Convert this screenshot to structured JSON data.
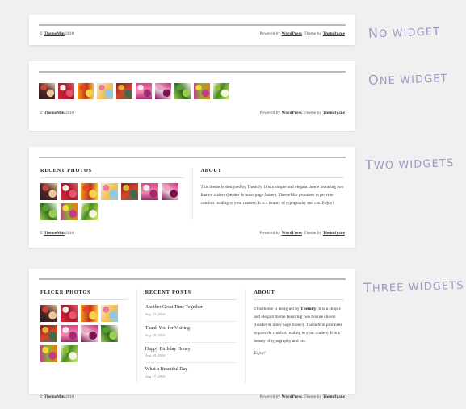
{
  "page": {
    "background": "#f0f0f0",
    "annotation_color": "#9a9ac4"
  },
  "footer": {
    "copyright_symbol": "©",
    "site_name": "ThemeMin",
    "year": "2010",
    "powered_prefix": "Powered by",
    "wordpress": "WordPress",
    "theme_prefix": ". Theme by",
    "themify": "Themify.me"
  },
  "annotations": [
    {
      "id": "no-widget",
      "first": "N",
      "rest": "o widget"
    },
    {
      "id": "one-widget",
      "first": "O",
      "rest": "ne widget"
    },
    {
      "id": "two-widgets",
      "first": "T",
      "rest": "wo widgets"
    },
    {
      "id": "three-widgets",
      "first": "T",
      "rest": "hree widgets"
    }
  ],
  "panels": {
    "no_widget": {
      "label": "No widget"
    },
    "one_widget": {
      "label": "One widget",
      "thumb_count": 10
    },
    "two_widgets": {
      "label": "Two widgets",
      "photos": {
        "heading": "Recent Photos",
        "thumb_count": 10
      },
      "about": {
        "heading": "About",
        "body": "This theme is designed by Themify. It is a simple and elegant theme featuring two feature sliders (header & inner page footer). ThemeMin promises to provide comfort reading to your readers. It is a beauty of typography and css. Enjoy!"
      }
    },
    "three_widgets": {
      "label": "Three widgets",
      "flickr": {
        "heading": "Flickr Photos",
        "thumb_count": 10
      },
      "posts": {
        "heading": "Recent Posts",
        "items": [
          {
            "title": "Another Great Time Together",
            "date": "Aug 22, 2010"
          },
          {
            "title": "Thank You for Visiting",
            "date": "Aug 19, 2010"
          },
          {
            "title": "Happy Birthday Honey",
            "date": "Aug 18, 2010"
          },
          {
            "title": "What a Beautiful Day",
            "date": "Aug 17, 2010"
          }
        ]
      },
      "about": {
        "heading": "About",
        "body_before_link": "This theme is designed by ",
        "link_text": "Themify",
        "body_after_link": ". It is a simple and elegant theme featuring two feature sliders (header & inner page footer). ThemeMin promises to provide comfort reading to your readers. It is a beauty of typography and css.",
        "closing": "Enjoy!"
      }
    }
  },
  "thumbnails": [
    {
      "name": "photo-dark-figure",
      "colors": [
        "#2b1b1d",
        "#c8463a",
        "#e8c79a",
        "#5a2a2c"
      ]
    },
    {
      "name": "photo-white-figure",
      "colors": [
        "#d6263c",
        "#f4f0ea",
        "#e2556a",
        "#a8172c"
      ]
    },
    {
      "name": "photo-orange-swirl",
      "colors": [
        "#f0a020",
        "#e8432a",
        "#f7d24a",
        "#c23018"
      ]
    },
    {
      "name": "photo-pastel-dancer",
      "colors": [
        "#f2e6dc",
        "#e87aa0",
        "#8fc7e8",
        "#f4c04a"
      ]
    },
    {
      "name": "photo-confetti-dark",
      "colors": [
        "#7a2a1e",
        "#e8b13a",
        "#3c6a4a",
        "#d8452c"
      ]
    },
    {
      "name": "photo-magenta-glow",
      "colors": [
        "#e0408c",
        "#f6ecec",
        "#a02a70",
        "#f08ab0"
      ]
    },
    {
      "name": "photo-pink-abstract",
      "colors": [
        "#d4247a",
        "#f2a0c0",
        "#7a1250",
        "#e8d0dc"
      ]
    },
    {
      "name": "photo-green-fern",
      "colors": [
        "#eef6e0",
        "#58a030",
        "#9ccc50",
        "#2e6a1c"
      ]
    },
    {
      "name": "photo-orange-floral",
      "colors": [
        "#f07a10",
        "#f6d83a",
        "#c43a8a",
        "#8ab030"
      ]
    },
    {
      "name": "photo-green-bird",
      "colors": [
        "#d8ee70",
        "#8cc030",
        "#f2f6e0",
        "#4a8a20"
      ]
    }
  ]
}
